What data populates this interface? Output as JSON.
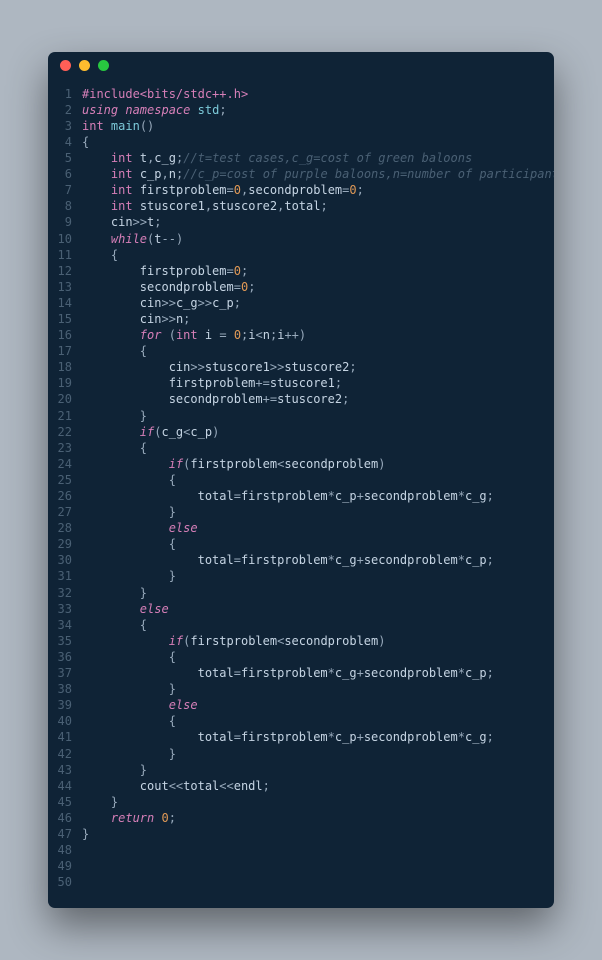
{
  "colors": {
    "background": "#aeb7c1",
    "window_bg": "#0f2336",
    "gutter": "#4a6074",
    "text": "#c5d4e3",
    "keyword": "#d67fb8",
    "type": "#d67fb8",
    "namespace": "#7cc9d8",
    "number": "#e09956",
    "comment": "#4a6074",
    "punct": "#97a9bb",
    "dot_red": "#ff5f57",
    "dot_yellow": "#febc2e",
    "dot_green": "#28c840"
  },
  "line_count": 50,
  "lines": [
    {
      "n": 1,
      "indent": 0,
      "tokens": [
        [
          "pp",
          "#include<bits/stdc++.h>"
        ]
      ]
    },
    {
      "n": 2,
      "indent": 0,
      "tokens": [
        [
          "kw",
          "using"
        ],
        [
          "sp",
          " "
        ],
        [
          "kw",
          "namespace"
        ],
        [
          "sp",
          " "
        ],
        [
          "ns",
          "std"
        ],
        [
          "punc",
          ";"
        ]
      ]
    },
    {
      "n": 3,
      "indent": 0,
      "tokens": [
        [
          "type",
          "int"
        ],
        [
          "sp",
          " "
        ],
        [
          "func",
          "main"
        ],
        [
          "punc",
          "()"
        ]
      ]
    },
    {
      "n": 4,
      "indent": 0,
      "tokens": [
        [
          "punc",
          "{"
        ]
      ]
    },
    {
      "n": 5,
      "indent": 1,
      "tokens": [
        [
          "type",
          "int"
        ],
        [
          "sp",
          " "
        ],
        [
          "id",
          "t"
        ],
        [
          "punc",
          ","
        ],
        [
          "id",
          "c_g"
        ],
        [
          "punc",
          ";"
        ],
        [
          "cmt",
          "//t=test cases,c_g=cost of green baloons"
        ]
      ]
    },
    {
      "n": 6,
      "indent": 1,
      "tokens": [
        [
          "type",
          "int"
        ],
        [
          "sp",
          " "
        ],
        [
          "id",
          "c_p"
        ],
        [
          "punc",
          ","
        ],
        [
          "id",
          "n"
        ],
        [
          "punc",
          ";"
        ],
        [
          "cmt",
          "//c_p=cost of purple baloons,n=number of participants"
        ]
      ]
    },
    {
      "n": 7,
      "indent": 1,
      "tokens": [
        [
          "type",
          "int"
        ],
        [
          "sp",
          " "
        ],
        [
          "id",
          "firstproblem"
        ],
        [
          "op",
          "="
        ],
        [
          "num",
          "0"
        ],
        [
          "punc",
          ","
        ],
        [
          "id",
          "secondproblem"
        ],
        [
          "op",
          "="
        ],
        [
          "num",
          "0"
        ],
        [
          "punc",
          ";"
        ]
      ]
    },
    {
      "n": 8,
      "indent": 1,
      "tokens": [
        [
          "type",
          "int"
        ],
        [
          "sp",
          " "
        ],
        [
          "id",
          "stuscore1"
        ],
        [
          "punc",
          ","
        ],
        [
          "id",
          "stuscore2"
        ],
        [
          "punc",
          ","
        ],
        [
          "id",
          "total"
        ],
        [
          "punc",
          ";"
        ]
      ]
    },
    {
      "n": 9,
      "indent": 1,
      "tokens": [
        [
          "id",
          "cin"
        ],
        [
          "op",
          ">>"
        ],
        [
          "id",
          "t"
        ],
        [
          "punc",
          ";"
        ]
      ]
    },
    {
      "n": 10,
      "indent": 1,
      "tokens": [
        [
          "kw",
          "while"
        ],
        [
          "punc",
          "("
        ],
        [
          "id",
          "t"
        ],
        [
          "op",
          "--"
        ],
        [
          "punc",
          ")"
        ]
      ]
    },
    {
      "n": 11,
      "indent": 1,
      "tokens": [
        [
          "punc",
          "{"
        ]
      ]
    },
    {
      "n": 12,
      "indent": 2,
      "tokens": [
        [
          "id",
          "firstproblem"
        ],
        [
          "op",
          "="
        ],
        [
          "num",
          "0"
        ],
        [
          "punc",
          ";"
        ]
      ]
    },
    {
      "n": 13,
      "indent": 2,
      "tokens": [
        [
          "id",
          "secondproblem"
        ],
        [
          "op",
          "="
        ],
        [
          "num",
          "0"
        ],
        [
          "punc",
          ";"
        ]
      ]
    },
    {
      "n": 14,
      "indent": 2,
      "tokens": [
        [
          "id",
          "cin"
        ],
        [
          "op",
          ">>"
        ],
        [
          "id",
          "c_g"
        ],
        [
          "op",
          ">>"
        ],
        [
          "id",
          "c_p"
        ],
        [
          "punc",
          ";"
        ]
      ]
    },
    {
      "n": 15,
      "indent": 2,
      "tokens": [
        [
          "id",
          "cin"
        ],
        [
          "op",
          ">>"
        ],
        [
          "id",
          "n"
        ],
        [
          "punc",
          ";"
        ]
      ]
    },
    {
      "n": 16,
      "indent": 2,
      "tokens": [
        [
          "kw",
          "for"
        ],
        [
          "sp",
          " "
        ],
        [
          "punc",
          "("
        ],
        [
          "type",
          "int"
        ],
        [
          "sp",
          " "
        ],
        [
          "id",
          "i"
        ],
        [
          "sp",
          " "
        ],
        [
          "op",
          "="
        ],
        [
          "sp",
          " "
        ],
        [
          "num",
          "0"
        ],
        [
          "punc",
          ";"
        ],
        [
          "id",
          "i"
        ],
        [
          "op",
          "<"
        ],
        [
          "id",
          "n"
        ],
        [
          "punc",
          ";"
        ],
        [
          "id",
          "i"
        ],
        [
          "op",
          "++"
        ],
        [
          "punc",
          ")"
        ]
      ]
    },
    {
      "n": 17,
      "indent": 2,
      "tokens": [
        [
          "punc",
          "{"
        ]
      ]
    },
    {
      "n": 18,
      "indent": 3,
      "tokens": [
        [
          "id",
          "cin"
        ],
        [
          "op",
          ">>"
        ],
        [
          "id",
          "stuscore1"
        ],
        [
          "op",
          ">>"
        ],
        [
          "id",
          "stuscore2"
        ],
        [
          "punc",
          ";"
        ]
      ]
    },
    {
      "n": 19,
      "indent": 3,
      "tokens": [
        [
          "id",
          "firstproblem"
        ],
        [
          "op",
          "+="
        ],
        [
          "id",
          "stuscore1"
        ],
        [
          "punc",
          ";"
        ]
      ]
    },
    {
      "n": 20,
      "indent": 3,
      "tokens": [
        [
          "id",
          "secondproblem"
        ],
        [
          "op",
          "+="
        ],
        [
          "id",
          "stuscore2"
        ],
        [
          "punc",
          ";"
        ]
      ]
    },
    {
      "n": 21,
      "indent": 2,
      "tokens": [
        [
          "punc",
          "}"
        ]
      ]
    },
    {
      "n": 22,
      "indent": 2,
      "tokens": [
        [
          "kw",
          "if"
        ],
        [
          "punc",
          "("
        ],
        [
          "id",
          "c_g"
        ],
        [
          "op",
          "<"
        ],
        [
          "id",
          "c_p"
        ],
        [
          "punc",
          ")"
        ]
      ]
    },
    {
      "n": 23,
      "indent": 2,
      "tokens": [
        [
          "punc",
          "{"
        ]
      ]
    },
    {
      "n": 24,
      "indent": 3,
      "tokens": [
        [
          "kw",
          "if"
        ],
        [
          "punc",
          "("
        ],
        [
          "id",
          "firstproblem"
        ],
        [
          "op",
          "<"
        ],
        [
          "id",
          "secondproblem"
        ],
        [
          "punc",
          ")"
        ]
      ]
    },
    {
      "n": 25,
      "indent": 3,
      "tokens": [
        [
          "punc",
          "{"
        ]
      ]
    },
    {
      "n": 26,
      "indent": 4,
      "tokens": [
        [
          "id",
          "total"
        ],
        [
          "op",
          "="
        ],
        [
          "id",
          "firstproblem"
        ],
        [
          "op",
          "*"
        ],
        [
          "id",
          "c_p"
        ],
        [
          "op",
          "+"
        ],
        [
          "id",
          "secondproblem"
        ],
        [
          "op",
          "*"
        ],
        [
          "id",
          "c_g"
        ],
        [
          "punc",
          ";"
        ]
      ]
    },
    {
      "n": 27,
      "indent": 3,
      "tokens": [
        [
          "punc",
          "}"
        ]
      ]
    },
    {
      "n": 28,
      "indent": 3,
      "tokens": [
        [
          "kw",
          "else"
        ]
      ]
    },
    {
      "n": 29,
      "indent": 3,
      "tokens": [
        [
          "punc",
          "{"
        ]
      ]
    },
    {
      "n": 30,
      "indent": 4,
      "tokens": [
        [
          "id",
          "total"
        ],
        [
          "op",
          "="
        ],
        [
          "id",
          "firstproblem"
        ],
        [
          "op",
          "*"
        ],
        [
          "id",
          "c_g"
        ],
        [
          "op",
          "+"
        ],
        [
          "id",
          "secondproblem"
        ],
        [
          "op",
          "*"
        ],
        [
          "id",
          "c_p"
        ],
        [
          "punc",
          ";"
        ]
      ]
    },
    {
      "n": 31,
      "indent": 3,
      "tokens": [
        [
          "punc",
          "}"
        ]
      ]
    },
    {
      "n": 32,
      "indent": 2,
      "tokens": [
        [
          "punc",
          "}"
        ]
      ]
    },
    {
      "n": 33,
      "indent": 2,
      "tokens": [
        [
          "kw",
          "else"
        ]
      ]
    },
    {
      "n": 34,
      "indent": 2,
      "tokens": [
        [
          "punc",
          "{"
        ]
      ]
    },
    {
      "n": 35,
      "indent": 3,
      "tokens": [
        [
          "kw",
          "if"
        ],
        [
          "punc",
          "("
        ],
        [
          "id",
          "firstproblem"
        ],
        [
          "op",
          "<"
        ],
        [
          "id",
          "secondproblem"
        ],
        [
          "punc",
          ")"
        ]
      ]
    },
    {
      "n": 36,
      "indent": 3,
      "tokens": [
        [
          "punc",
          "{"
        ]
      ]
    },
    {
      "n": 37,
      "indent": 4,
      "tokens": [
        [
          "id",
          "total"
        ],
        [
          "op",
          "="
        ],
        [
          "id",
          "firstproblem"
        ],
        [
          "op",
          "*"
        ],
        [
          "id",
          "c_g"
        ],
        [
          "op",
          "+"
        ],
        [
          "id",
          "secondproblem"
        ],
        [
          "op",
          "*"
        ],
        [
          "id",
          "c_p"
        ],
        [
          "punc",
          ";"
        ]
      ]
    },
    {
      "n": 38,
      "indent": 3,
      "tokens": [
        [
          "punc",
          "}"
        ]
      ]
    },
    {
      "n": 39,
      "indent": 3,
      "tokens": [
        [
          "kw",
          "else"
        ]
      ]
    },
    {
      "n": 40,
      "indent": 3,
      "tokens": [
        [
          "punc",
          "{"
        ]
      ]
    },
    {
      "n": 41,
      "indent": 4,
      "tokens": [
        [
          "id",
          "total"
        ],
        [
          "op",
          "="
        ],
        [
          "id",
          "firstproblem"
        ],
        [
          "op",
          "*"
        ],
        [
          "id",
          "c_p"
        ],
        [
          "op",
          "+"
        ],
        [
          "id",
          "secondproblem"
        ],
        [
          "op",
          "*"
        ],
        [
          "id",
          "c_g"
        ],
        [
          "punc",
          ";"
        ]
      ]
    },
    {
      "n": 42,
      "indent": 3,
      "tokens": [
        [
          "punc",
          "}"
        ]
      ]
    },
    {
      "n": 43,
      "indent": 2,
      "tokens": [
        [
          "punc",
          "}"
        ]
      ]
    },
    {
      "n": 44,
      "indent": 2,
      "tokens": [
        [
          "id",
          "cout"
        ],
        [
          "op",
          "<<"
        ],
        [
          "id",
          "total"
        ],
        [
          "op",
          "<<"
        ],
        [
          "id",
          "endl"
        ],
        [
          "punc",
          ";"
        ]
      ]
    },
    {
      "n": 45,
      "indent": 1,
      "tokens": [
        [
          "punc",
          "}"
        ]
      ]
    },
    {
      "n": 46,
      "indent": 1,
      "tokens": [
        [
          "kw",
          "return"
        ],
        [
          "sp",
          " "
        ],
        [
          "num",
          "0"
        ],
        [
          "punc",
          ";"
        ]
      ]
    },
    {
      "n": 47,
      "indent": 0,
      "tokens": [
        [
          "punc",
          "}"
        ]
      ]
    },
    {
      "n": 48,
      "indent": 0,
      "tokens": []
    },
    {
      "n": 49,
      "indent": 0,
      "tokens": []
    },
    {
      "n": 50,
      "indent": 0,
      "tokens": []
    }
  ]
}
